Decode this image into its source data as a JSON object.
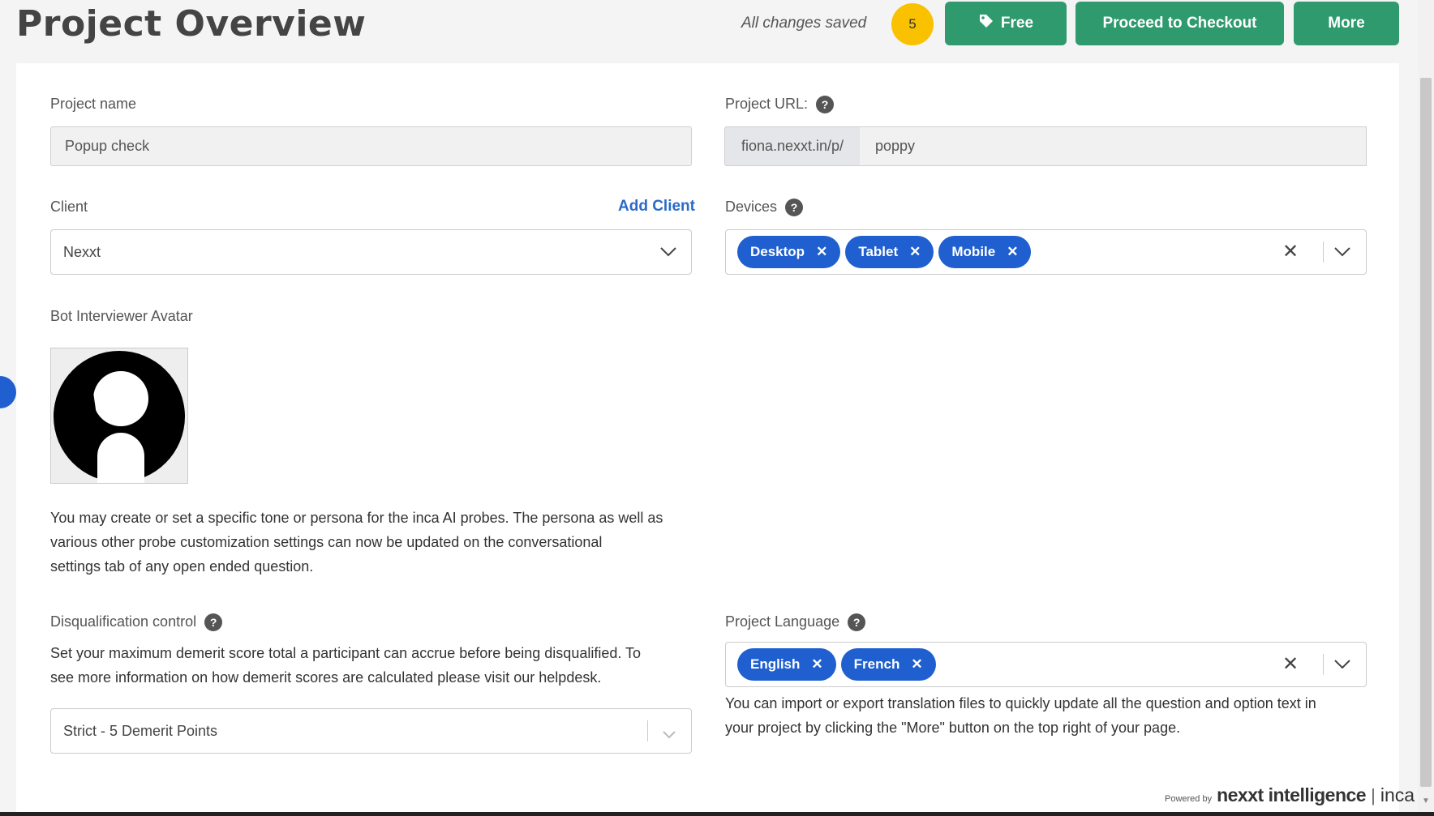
{
  "header": {
    "title": "Project Overview",
    "saved_status": "All changes saved",
    "count_badge": "5",
    "free_label": "Free",
    "checkout_label": "Proceed to Checkout",
    "more_label": "More"
  },
  "form": {
    "project_name": {
      "label": "Project name",
      "value": "Popup check"
    },
    "project_url": {
      "label": "Project URL:",
      "prefix": "fiona.nexxt.in/p/",
      "value": "poppy"
    },
    "client": {
      "label": "Client",
      "add_label": "Add Client",
      "value": "Nexxt"
    },
    "devices": {
      "label": "Devices",
      "chips": [
        "Desktop",
        "Tablet",
        "Mobile"
      ]
    },
    "avatar": {
      "label": "Bot Interviewer Avatar"
    },
    "persona_note": "You may create or set a specific tone or persona for the inca AI probes. The persona as well as various other probe customization settings can now be updated on the conversational settings tab of any open ended question.",
    "persona_lines": [
      "You may create or set a specific tone or persona for the inca AI probes. The persona as well as",
      "various other probe customization settings can now be updated on the conversational",
      "settings tab of any open ended question."
    ],
    "disqualification": {
      "label": "Disqualification control",
      "help_lines": [
        "Set your maximum demerit score total a participant can accrue before being disqualified. To",
        "see more information on how demerit scores are calculated please visit our helpdesk."
      ],
      "value": "Strict - 5 Demerit Points"
    },
    "language": {
      "label": "Project Language",
      "chips": [
        "English",
        "French"
      ],
      "help_lines": [
        "You can import or export translation files to quickly update all the question and option text in",
        "your project by clicking the \"More\" button on the top right of your page."
      ]
    }
  },
  "footer": {
    "powered_by": "Powered by",
    "brand": "nexxt intelligence",
    "product": "inca"
  },
  "colors": {
    "primary_green": "#2f9a6e",
    "chip_blue": "#1f5fcf",
    "badge_yellow": "#f9c100",
    "link_blue": "#2a6bc9"
  }
}
